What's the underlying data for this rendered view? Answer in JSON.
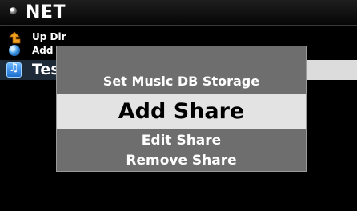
{
  "header": {
    "title": "NET",
    "icon": "disc-icon"
  },
  "list": {
    "items": [
      {
        "label": "Up Dir",
        "icon": "up-arrow-icon"
      },
      {
        "label": "Add",
        "icon": "globe-icon"
      },
      {
        "label": "Tes",
        "icon": "music-folder-icon"
      }
    ]
  },
  "popup": {
    "items": [
      {
        "label": "Set Music DB Storage"
      },
      {
        "label": "Add Share",
        "selected": true
      },
      {
        "label": "Edit Share"
      },
      {
        "label": "Remove Share"
      }
    ],
    "highlight_color": "#e3e3e3",
    "background_color": "#6e6e6e"
  }
}
